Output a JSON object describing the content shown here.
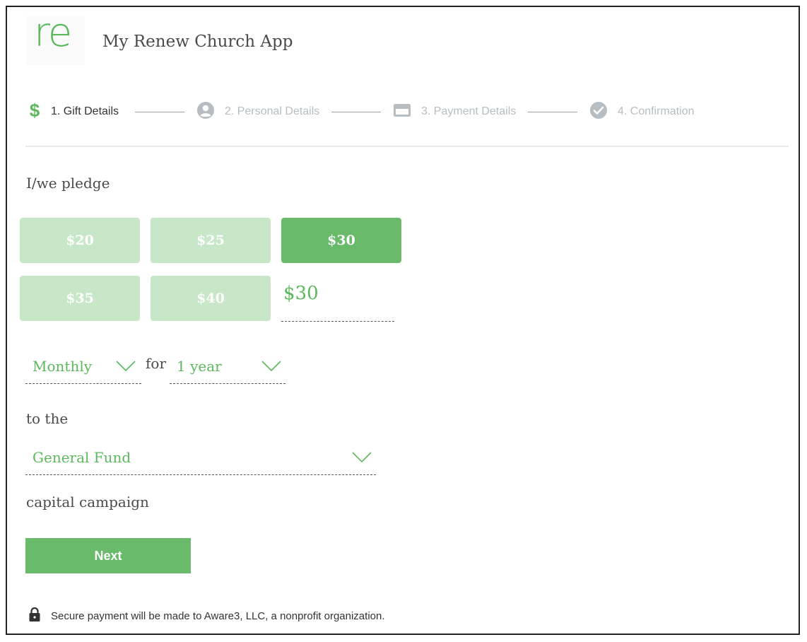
{
  "header": {
    "logo_text": "re",
    "app_title": "My Renew Church App"
  },
  "stepper": {
    "steps": [
      {
        "label": "1. Gift Details",
        "icon": "dollar-icon",
        "state": "active"
      },
      {
        "label": "2. Personal Details",
        "icon": "user-icon",
        "state": "inactive"
      },
      {
        "label": "3. Payment Details",
        "icon": "credit-card-icon",
        "state": "inactive"
      },
      {
        "label": "4. Confirmation",
        "icon": "check-circle-icon",
        "state": "inactive"
      }
    ]
  },
  "form": {
    "pledge_label": "I/we pledge",
    "amounts": [
      {
        "label": "$20",
        "selected": false
      },
      {
        "label": "$25",
        "selected": false
      },
      {
        "label": "$30",
        "selected": true
      },
      {
        "label": "$35",
        "selected": false
      },
      {
        "label": "$40",
        "selected": false
      }
    ],
    "custom_amount": "$30",
    "frequency": "Monthly",
    "for_label": "for",
    "duration": "1 year",
    "to_label": "to the",
    "fund": "General Fund",
    "campaign_label": "capital campaign",
    "next_label": "Next"
  },
  "footer": {
    "secure_text": "Secure payment will be made to Aware3, LLC, a nonprofit organization.",
    "icon": "lock-icon"
  },
  "colors": {
    "accent": "#69bb6b",
    "accent_light": "#c8e7c8",
    "text_green": "#5cb85c",
    "inactive": "#b8bdc2"
  }
}
